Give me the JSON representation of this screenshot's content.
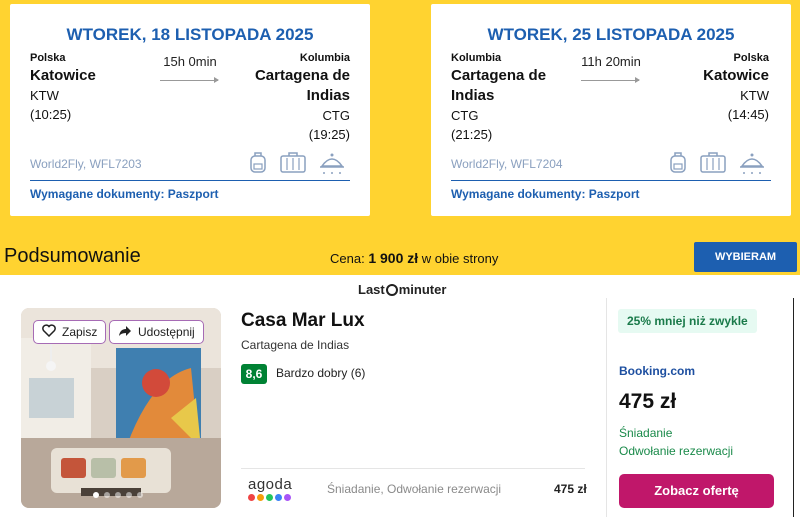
{
  "flights": {
    "outbound": {
      "date": "WTOREK, 18 LISTOPADA 2025",
      "from": {
        "country": "Polska",
        "city": "Katowice",
        "code": "KTW",
        "time": "(10:25)"
      },
      "duration": "15h 0min",
      "to": {
        "country": "Kolumbia",
        "city": "Cartagena de Indias",
        "code": "CTG",
        "time": "(19:25)"
      },
      "flight": "World2Fly, WFL7203",
      "documents": "Wymagane dokumenty: Paszport"
    },
    "return": {
      "date": "WTOREK, 25 LISTOPADA 2025",
      "from": {
        "country": "Kolumbia",
        "city": "Cartagena de Indias",
        "code": "CTG",
        "time": "(21:25)"
      },
      "duration": "11h 20min",
      "to": {
        "country": "Polska",
        "city": "Katowice",
        "code": "KTW",
        "time": "(14:45)"
      },
      "flight": "World2Fly, WFL7204",
      "documents": "Wymagane dokumenty: Paszport"
    }
  },
  "summary": {
    "label": "Podsumowanie",
    "price_prefix": "Cena:",
    "price_value": "1 900 zł",
    "price_suffix": "w obie strony",
    "choose_button": "WYBIERAM"
  },
  "brand": {
    "part1": "Last",
    "part2": "minuter"
  },
  "hotel": {
    "save_label": "Zapisz",
    "share_label": "Udostępnij",
    "name": "Casa Mar Lux",
    "city": "Cartagena de Indias",
    "score": "8,6",
    "score_text": "Bardzo dobry (6)",
    "photo_count": 5,
    "photo_active": 1
  },
  "provider_row": {
    "logo": "agoda",
    "dot_colors": [
      "#ef4444",
      "#f59e0b",
      "#22c55e",
      "#3b82f6",
      "#a855f7"
    ],
    "description": "Śniadanie, Odwołanie rezerwacji",
    "price": "475 zł"
  },
  "offer": {
    "deal_badge": "25% mniej niż zwykle",
    "provider": "Booking.com",
    "price": "475 zł",
    "feature1": "Śniadanie",
    "feature2": "Odwołanie rezerwacji",
    "button": "Zobacz ofertę"
  },
  "colors": {
    "yellow": "#ffd330",
    "blue": "#1d5fb0",
    "green_score": "#008234",
    "offer_button": "#c0176a"
  }
}
